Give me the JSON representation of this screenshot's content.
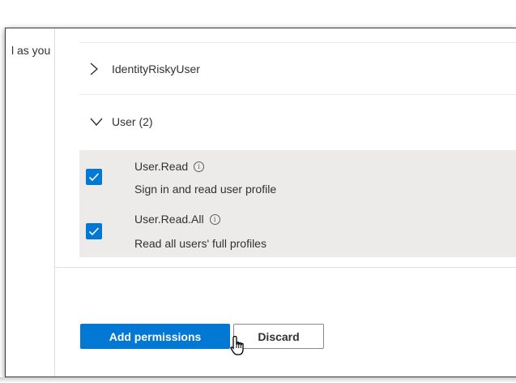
{
  "background_text": "l as you",
  "permission_groups": [
    {
      "label": "IdentityRiskyUser",
      "expanded": false,
      "icon": "chevron-right-icon"
    },
    {
      "label": "User (2)",
      "expanded": true,
      "icon": "chevron-down-icon"
    }
  ],
  "permissions": [
    {
      "name": "User.Read",
      "description": "Sign in and read user profile",
      "checked": true
    },
    {
      "name": "User.Read.All",
      "description": "Read all users' full profiles",
      "checked": true
    }
  ],
  "info_icon_glyph": "i",
  "buttons": {
    "add_label": "Add permissions",
    "discard_label": "Discard"
  },
  "colors": {
    "accent": "#0078d4",
    "row_highlight": "#edebe9"
  },
  "cursor": "hand-pointer-icon"
}
